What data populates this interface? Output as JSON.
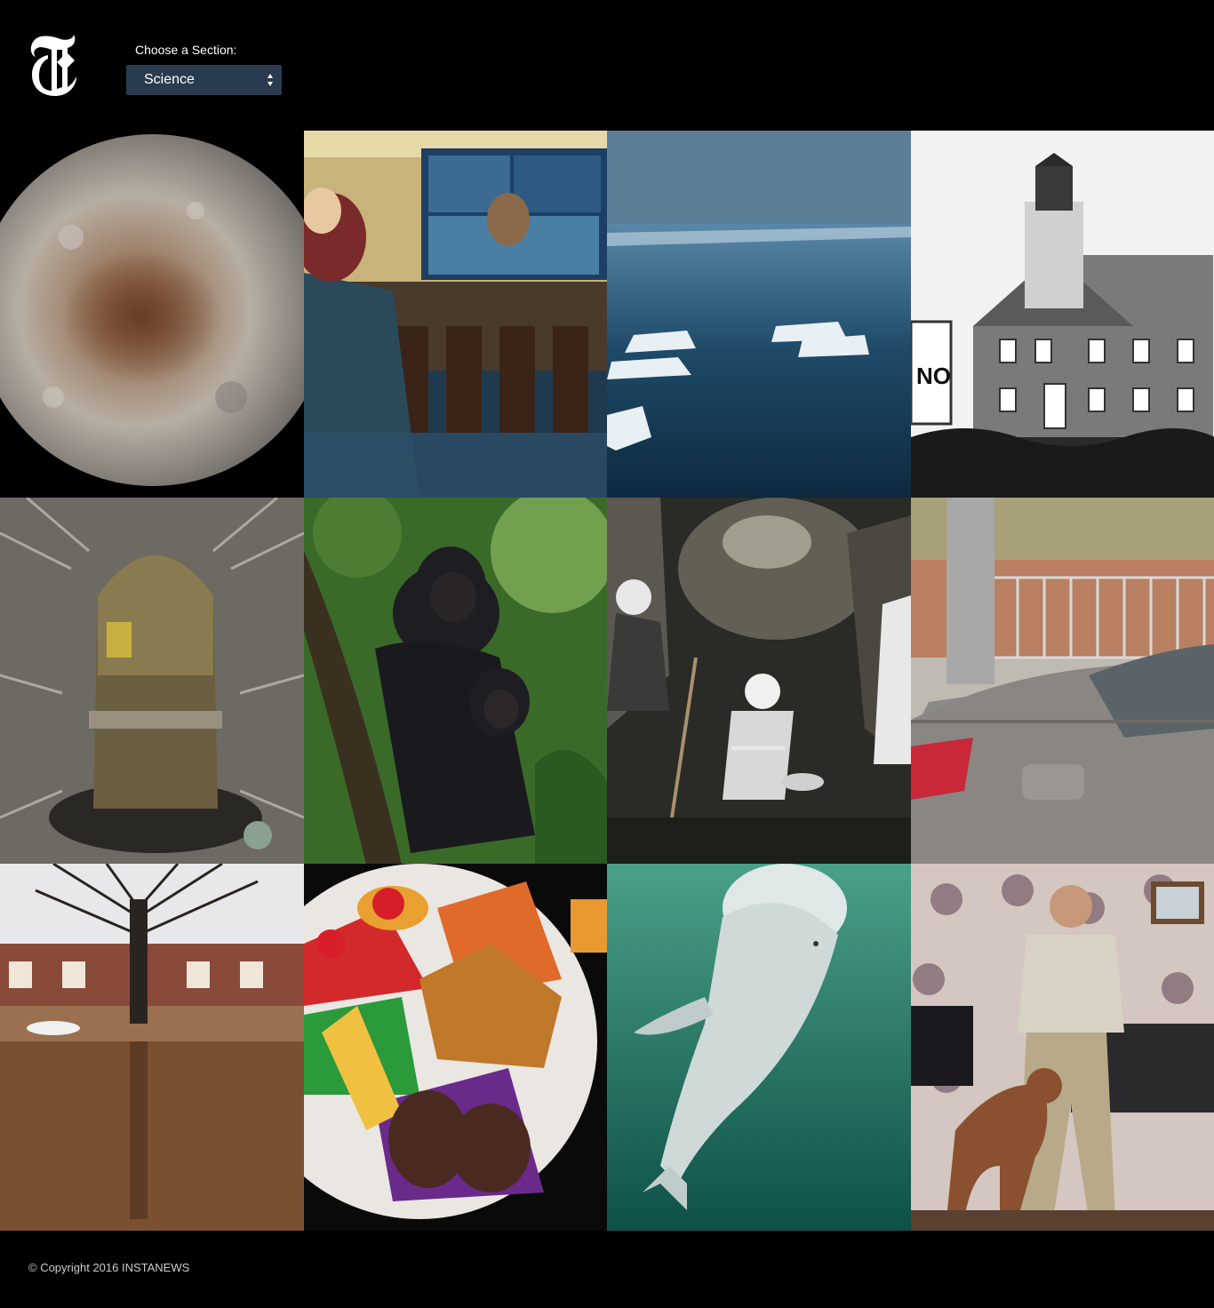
{
  "header": {
    "logo": "nyt-t-logo",
    "section_label": "Choose a Section:",
    "select": {
      "value": "Science",
      "icon": "select-arrows-icon"
    }
  },
  "articles": [
    {
      "image": "charon-moon"
    },
    {
      "image": "congressional-hearing"
    },
    {
      "image": "arctic-icebergs"
    },
    {
      "image": "lighthouse"
    },
    {
      "image": "missile-silo"
    },
    {
      "image": "bonobos"
    },
    {
      "image": "cave-excavation"
    },
    {
      "image": "car-street"
    },
    {
      "image": "flooded-street"
    },
    {
      "image": "food-plate"
    },
    {
      "image": "beluga-whale"
    },
    {
      "image": "man-with-dog"
    }
  ],
  "footer": {
    "copyright": "© Copyright 2016 INSTANEWS"
  }
}
